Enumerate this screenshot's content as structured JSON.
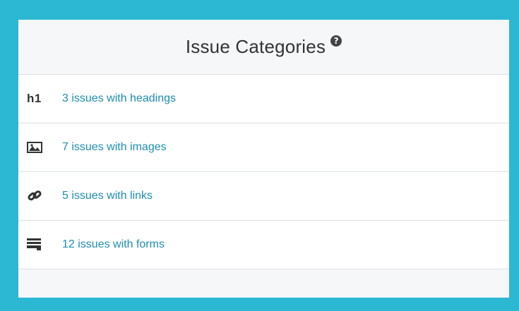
{
  "panel": {
    "title": "Issue Categories",
    "help_glyph": "?"
  },
  "categories": [
    {
      "icon": "heading-icon",
      "icon_text": "h1",
      "label": "3 issues with headings"
    },
    {
      "icon": "image-icon",
      "label": "7 issues with images"
    },
    {
      "icon": "link-icon",
      "label": "5 issues with links"
    },
    {
      "icon": "form-icon",
      "label": "12 issues with forms"
    }
  ],
  "colors": {
    "frame_border": "#2cb8d2",
    "link": "#1d8db1",
    "panel_bg": "#f6f7f9",
    "row_bg": "#ffffff"
  }
}
